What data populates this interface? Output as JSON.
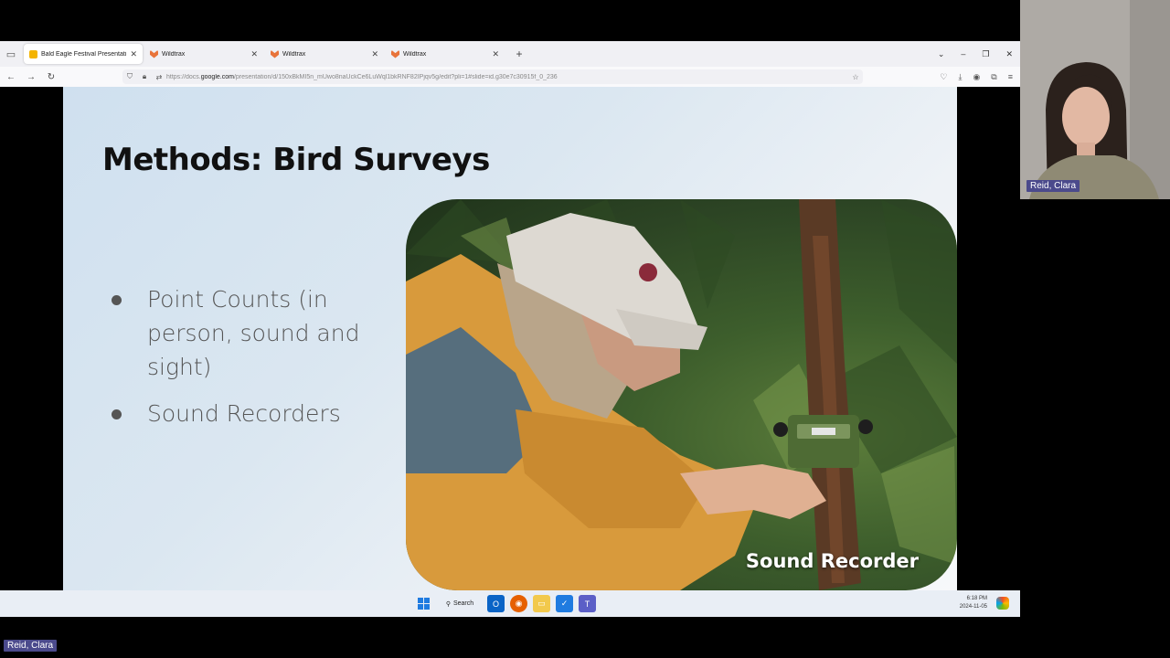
{
  "browser": {
    "tabs": [
      {
        "title": "Bald Eagle Festival Presentation",
        "active": true,
        "icon": "slides-icon"
      },
      {
        "title": "Wildtrax",
        "active": false,
        "icon": "wildtrax-icon"
      },
      {
        "title": "Wildtrax",
        "active": false,
        "icon": "wildtrax-icon"
      },
      {
        "title": "Wildtrax",
        "active": false,
        "icon": "wildtrax-icon"
      }
    ],
    "url_prefix": "https://docs.",
    "url_domain": "google.com",
    "url_path": "/presentation/d/150xBkMI5n_mUwo8naUckCe6LuWql1bkRNF82IPjqv5g/edit?pli=1#slide=id.g30e7c30915f_0_236"
  },
  "slide": {
    "title": "Methods: Bird Surveys",
    "bullets": [
      "Point Counts (in person, sound and sight)",
      "Sound Recorders"
    ],
    "photo_caption": "Sound Recorder"
  },
  "taskbar": {
    "search_label": "Search",
    "time": "6:18 PM",
    "date": "2024-11-05"
  },
  "participant": {
    "name": "Reid, Clara",
    "self_label": "Reid, Clara"
  },
  "colors": {
    "name_tag": "#4b4a8c",
    "slide_bg": "#dbe7f1",
    "accent_tab": "#f4b400"
  }
}
